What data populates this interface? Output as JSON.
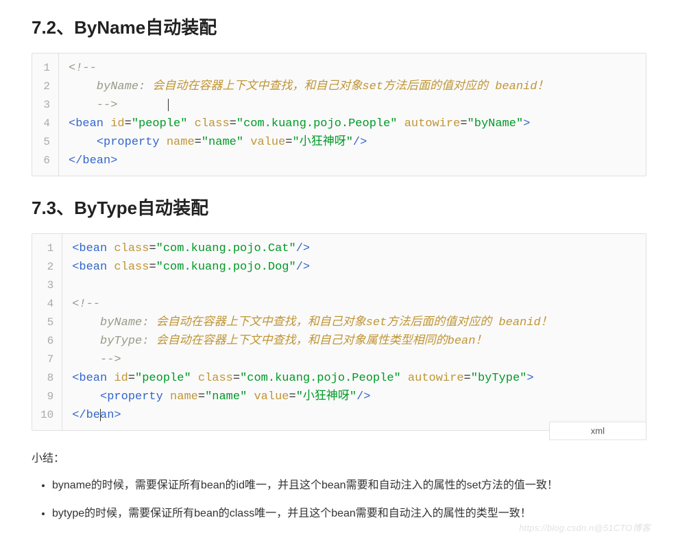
{
  "section1": {
    "heading": "7.2、ByName自动装配"
  },
  "code1": {
    "l1": "<!--",
    "l2_prefix": "    byName: ",
    "l2_text": "会自动在容器上下文中查找，和自己对象set方法后面的值对应的 beanid！",
    "l3": "    -->",
    "l4": {
      "tag": "bean",
      "id_attr": "id",
      "id_val": "\"people\"",
      "class_attr": "class",
      "class_val": "\"com.kuang.pojo.People\"",
      "autowire_attr": "autowire",
      "autowire_val": "\"byName\""
    },
    "l5": {
      "tag": "property",
      "name_attr": "name",
      "name_val": "\"name\"",
      "value_attr": "value",
      "value_val": "\"小狂神呀\""
    },
    "l6": {
      "tag": "bean"
    },
    "line_numbers": [
      "1",
      "2",
      "3",
      "4",
      "5",
      "6"
    ]
  },
  "section2": {
    "heading": "7.3、ByType自动装配"
  },
  "code2": {
    "l1": {
      "tag": "bean",
      "class_attr": "class",
      "class_val": "\"com.kuang.pojo.Cat\""
    },
    "l2": {
      "tag": "bean",
      "class_attr": "class",
      "class_val": "\"com.kuang.pojo.Dog\""
    },
    "l4": "<!--",
    "l5_prefix": "    byName: ",
    "l5_text": "会自动在容器上下文中查找，和自己对象set方法后面的值对应的 beanid！",
    "l6_prefix": "    byType: ",
    "l6_text": "会自动在容器上下文中查找，和自己对象属性类型相同的bean！",
    "l7": "    -->",
    "l8": {
      "tag": "bean",
      "id_attr": "id",
      "id_val": "\"people\"",
      "class_attr": "class",
      "class_val": "\"com.kuang.pojo.People\"",
      "autowire_attr": "autowire",
      "autowire_val": "\"byType\""
    },
    "l9": {
      "tag": "property",
      "name_attr": "name",
      "name_val": "\"name\"",
      "value_attr": "value",
      "value_val": "\"小狂神呀\""
    },
    "l10": {
      "tag": "bean"
    },
    "line_numbers": [
      "1",
      "2",
      "3",
      "4",
      "5",
      "6",
      "7",
      "8",
      "9",
      "10"
    ]
  },
  "lang_badge": "xml",
  "summary": {
    "label": "小结：",
    "item1": "byname的时候，需要保证所有bean的id唯一，并且这个bean需要和自动注入的属性的set方法的值一致！",
    "item2": "bytype的时候，需要保证所有bean的class唯一，并且这个bean需要和自动注入的属性的类型一致！"
  },
  "watermark": "https://blog.csdn.n@51CTO博客"
}
